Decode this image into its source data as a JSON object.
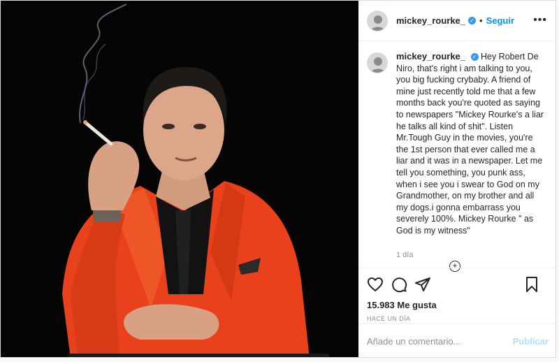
{
  "header": {
    "username": "mickey_rourke_",
    "follow_label": "Seguir",
    "more_label": "•••"
  },
  "caption": {
    "username": "mickey_rourke_",
    "text": "Hey Robert De Niro, that's right i am talking to you, you big fucking crybaby. A friend of mine just recently told me that a few months back you're quoted as saying to newspapers \"Mickey Rourke's a liar he talks all kind of shit\". Listen Mr.Tough Guy in the movies, you're the 1st person that ever called me a liar and it was in a newspaper. Let me tell you something, you punk ass, when i see you i swear to God on my Grandmother, on my brother and all my dogs.i gonna embarrass you severely 100%. Mickey Rourke \" as God is my witness\"",
    "time": "1 día"
  },
  "actions": {
    "likes": "15.983 Me gusta",
    "ago": "HACE UN DÍA"
  },
  "comment_box": {
    "placeholder": "Añade un comentario...",
    "publish_label": "Publicar"
  },
  "colors": {
    "accent": "#0095f6",
    "publish_disabled": "#b2dffc",
    "suit": "#e8411c",
    "photo_background": "#050505"
  }
}
